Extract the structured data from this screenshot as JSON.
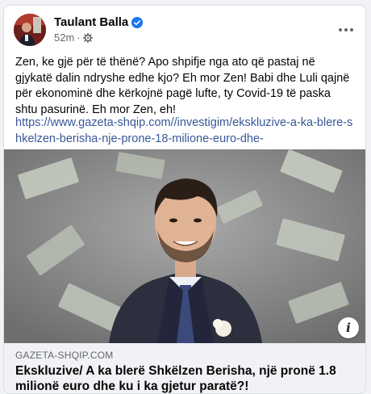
{
  "post": {
    "author": "Taulant Balla",
    "time": "52m",
    "separator": "·",
    "body": "Zen, ke gjë për të thënë? Apo shpifje nga ato që pastaj në gjykatë dalin ndryshe edhe kjo? Eh mor Zen! Babi dhe Luli qajnë për ekonominë dhe kërkojnë pagë lufte, ty Covid-19 të paska shtu pasurinë. Eh mor Zen, eh!",
    "link": "https://www.gazeta-shqip.com//investigim/ekskluzive-a-ka-blere-shkelzen-berisha-nje-prone-18-milione-euro-dhe-"
  },
  "link_preview": {
    "domain": "GAZETA-SHQIP.COM",
    "headline": "Ekskluzive/ A ka blerë Shkëlzen Berisha, një pronë 1.8 milionë euro dhe ku i ka gjetur paratë?!",
    "info_label": "i"
  },
  "icons": {
    "verified": "verified-badge-icon",
    "audience": "gear-icon",
    "more": "more-options-icon",
    "info": "info-icon"
  },
  "colors": {
    "link": "#385898",
    "verified": "#1877f2",
    "secondary_text": "#65676b",
    "preview_bg": "#f0f2f5"
  }
}
